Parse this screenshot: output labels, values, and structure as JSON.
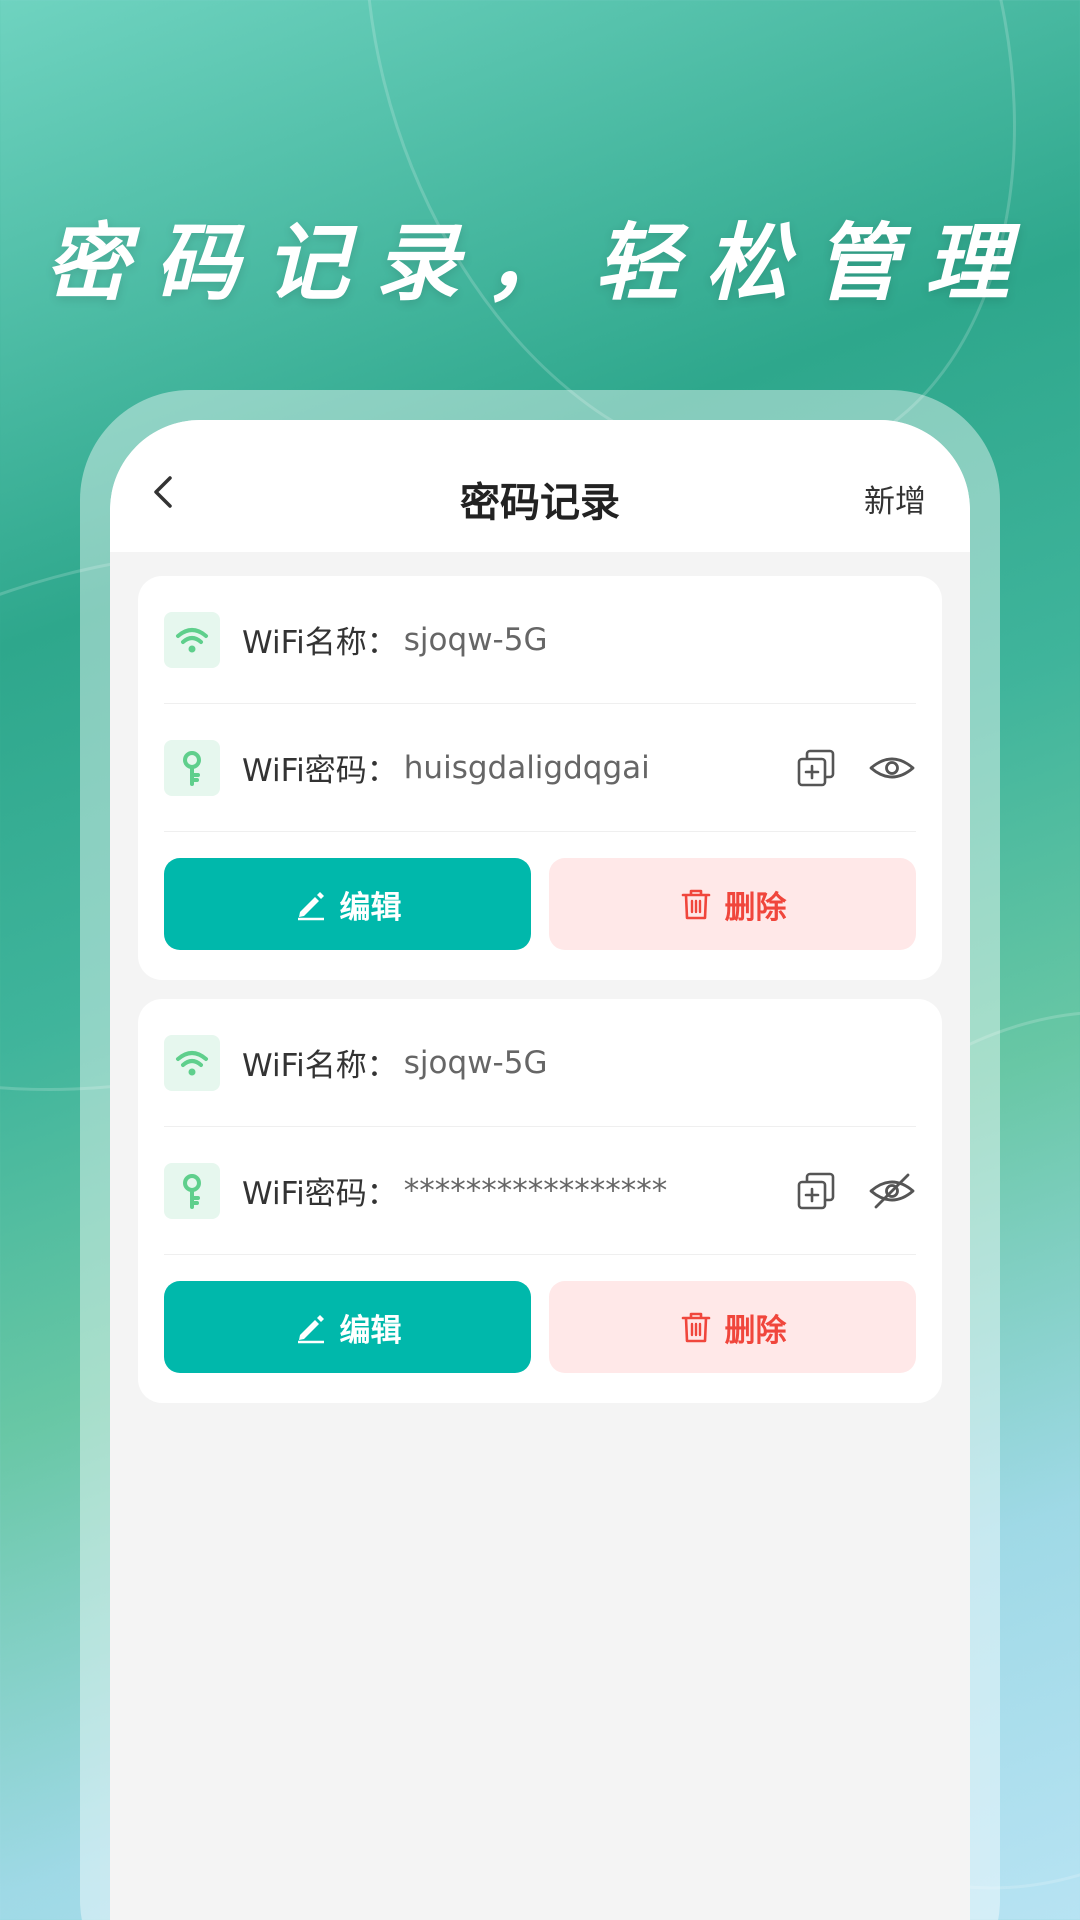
{
  "headline": "密码记录，轻松管理",
  "navbar": {
    "title": "密码记录",
    "action_label": "新增"
  },
  "records": [
    {
      "name_label": "WiFi名称：",
      "name_value": "sjoqw-5G",
      "password_label": "WiFi密码：",
      "password_value": "huisgdaligdqgai",
      "password_visible": true,
      "edit_label": "编辑",
      "delete_label": "删除"
    },
    {
      "name_label": "WiFi名称：",
      "name_value": "sjoqw-5G",
      "password_label": "WiFi密码：",
      "password_value": "*****************",
      "password_visible": false,
      "edit_label": "编辑",
      "delete_label": "删除"
    }
  ],
  "icons": {
    "back": "chevron-left-icon",
    "wifi": "wifi-icon",
    "key": "key-icon",
    "copy": "copy-icon",
    "eye": "eye-icon",
    "eye_off": "eye-off-icon",
    "edit": "pencil-icon",
    "delete": "trash-icon"
  },
  "colors": {
    "primary": "#00b8ab",
    "danger": "#f0463c",
    "danger_bg": "#ffe8e8",
    "icon_green": "#5fcf8c"
  }
}
